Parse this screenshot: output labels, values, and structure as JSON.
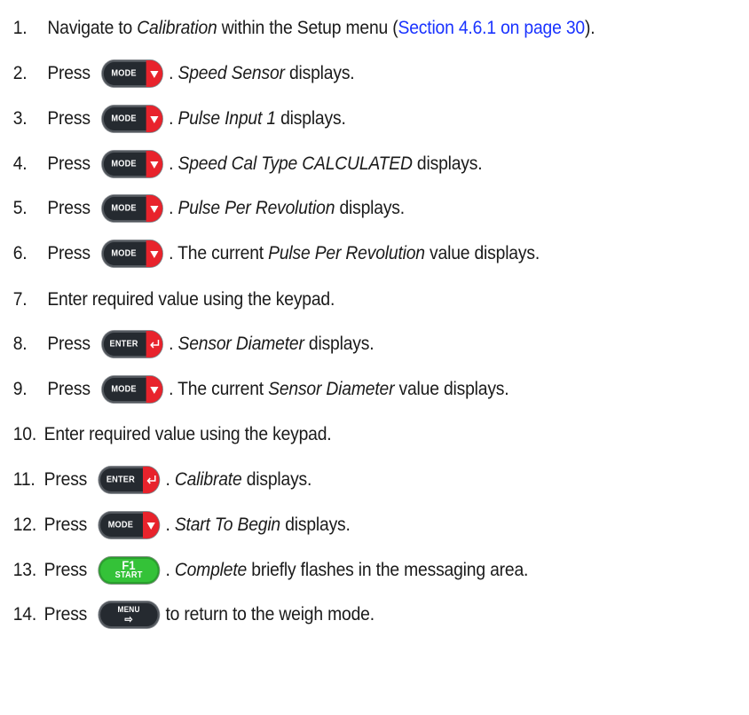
{
  "steps": [
    {
      "n": "1.",
      "parts": [
        {
          "t": "Navigate to "
        },
        {
          "t": "Calibration",
          "i": true
        },
        {
          "t": " within the Setup menu ("
        },
        {
          "t": "Section 4.6.1 on page 30",
          "link": true
        },
        {
          "t": ")."
        }
      ]
    },
    {
      "n": "2.",
      "press": "Press",
      "key": "mode",
      "parts": [
        {
          "t": ". "
        },
        {
          "t": "Speed Sensor",
          "i": true
        },
        {
          "t": " displays."
        }
      ]
    },
    {
      "n": "3.",
      "press": "Press",
      "key": "mode",
      "parts": [
        {
          "t": ". "
        },
        {
          "t": "Pulse Input 1",
          "i": true
        },
        {
          "t": " displays."
        }
      ]
    },
    {
      "n": "4.",
      "press": "Press",
      "key": "mode",
      "parts": [
        {
          "t": ". "
        },
        {
          "t": "Speed Cal Type CALCULATED",
          "i": true
        },
        {
          "t": " displays."
        }
      ]
    },
    {
      "n": "5.",
      "press": "Press",
      "key": "mode",
      "parts": [
        {
          "t": ". "
        },
        {
          "t": "Pulse Per Revolution",
          "i": true
        },
        {
          "t": " displays."
        }
      ]
    },
    {
      "n": "6.",
      "press": "Press",
      "key": "mode",
      "parts": [
        {
          "t": ". The current "
        },
        {
          "t": "Pulse Per Revolution",
          "i": true
        },
        {
          "t": " value displays."
        }
      ]
    },
    {
      "n": "7.",
      "parts": [
        {
          "t": "Enter required value using the keypad."
        }
      ]
    },
    {
      "n": "8.",
      "press": "Press",
      "key": "enter",
      "parts": [
        {
          "t": ". "
        },
        {
          "t": "Sensor Diameter",
          "i": true
        },
        {
          "t": " displays."
        }
      ]
    },
    {
      "n": "9.",
      "press": "Press",
      "key": "mode",
      "parts": [
        {
          "t": ". The current "
        },
        {
          "t": "Sensor Diameter",
          "i": true
        },
        {
          "t": " value displays."
        }
      ]
    },
    {
      "n": "10.",
      "parts": [
        {
          "t": "Enter required value using the keypad."
        }
      ]
    },
    {
      "n": "11.",
      "press": "Press",
      "key": "enter",
      "parts": [
        {
          "t": ". "
        },
        {
          "t": "Calibrate",
          "i": true
        },
        {
          "t": " displays."
        }
      ]
    },
    {
      "n": "12.",
      "press": "Press",
      "key": "mode",
      "parts": [
        {
          "t": ". "
        },
        {
          "t": "Start To Begin",
          "i": true
        },
        {
          "t": " displays."
        }
      ]
    },
    {
      "n": "13.",
      "press": "Press",
      "key": "f1",
      "parts": [
        {
          "t": ". "
        },
        {
          "t": "Complete",
          "i": true
        },
        {
          "t": " briefly flashes in the messaging area."
        }
      ]
    },
    {
      "n": "14.",
      "press": "Press",
      "key": "menu",
      "parts": [
        {
          "t": " to return to the weigh mode."
        }
      ]
    }
  ],
  "keys": {
    "mode": {
      "label": "MODE",
      "icon": "down-triangle-icon"
    },
    "enter": {
      "label": "ENTER",
      "icon": "enter-arrow-icon"
    },
    "f1": {
      "label": "F1",
      "sub": "START"
    },
    "menu": {
      "label": "MENU",
      "icon": "exit-arrow-icon"
    }
  },
  "colors": {
    "link": "#1a33ff",
    "key_dark": "#252a30",
    "key_red": "#e8232c",
    "key_green": "#34c238"
  }
}
